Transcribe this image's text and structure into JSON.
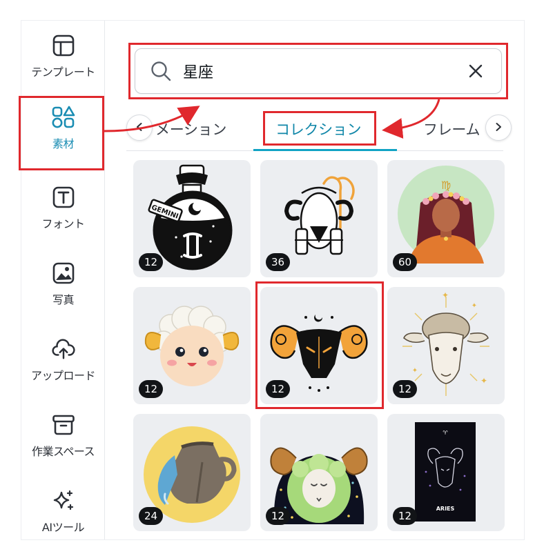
{
  "sidebar": {
    "items": [
      {
        "label": "テンプレート",
        "icon": "template-layout-icon"
      },
      {
        "label": "素材",
        "icon": "elements-shapes-icon",
        "active": true
      },
      {
        "label": "フォント",
        "icon": "text-t-icon"
      },
      {
        "label": "写真",
        "icon": "photo-image-icon"
      },
      {
        "label": "アップロード",
        "icon": "cloud-upload-icon"
      },
      {
        "label": "作業スペース",
        "icon": "archive-box-icon"
      },
      {
        "label": "AIツール",
        "icon": "sparkle-ai-icon"
      }
    ]
  },
  "search": {
    "value": "星座",
    "icon": "search-icon",
    "clear_icon": "close-icon"
  },
  "tabs": {
    "items": [
      "メーション",
      "コレクション",
      "フレーム"
    ],
    "active": "コレクション",
    "prev_icon": "chevron-left-icon",
    "next_icon": "chevron-right-icon"
  },
  "grid": {
    "items": [
      {
        "name": "gemini-potion-bottle",
        "count": "12",
        "badge_text": "GEMINI"
      },
      {
        "name": "aries-line-art-ram",
        "count": "36"
      },
      {
        "name": "virgo-woman-flowers",
        "count": "60"
      },
      {
        "name": "cute-sheep-face",
        "count": "12"
      },
      {
        "name": "black-ram-orange-horns",
        "count": "12"
      },
      {
        "name": "sheep-head-sunburst",
        "count": "12"
      },
      {
        "name": "aquarius-water-jug",
        "count": "24"
      },
      {
        "name": "green-ram-stars",
        "count": "12"
      },
      {
        "name": "aries-tarot-card",
        "count": "12",
        "caption": "ARIES"
      }
    ]
  },
  "colors": {
    "accent": "#11a3c4",
    "annotation": "#e0282d",
    "active_bg": "#e9f6fa",
    "card_bg": "#eceef1"
  }
}
